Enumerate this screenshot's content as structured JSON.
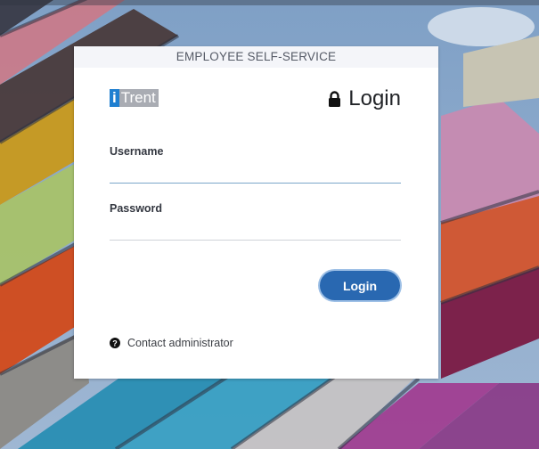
{
  "header": {
    "title": "EMPLOYEE SELF-SERVICE"
  },
  "brand": {
    "logo_i": "i",
    "logo_text": "Trent",
    "logo_i_color": "#1f7fd0",
    "logo_text_bg": "#a9acb3"
  },
  "login": {
    "title": "Login",
    "lock_icon": "lock-icon"
  },
  "form": {
    "username_label": "Username",
    "username_value": "",
    "password_label": "Password",
    "password_value": "",
    "submit_label": "Login",
    "accent_color": "#2968b1"
  },
  "footer": {
    "help_icon": "question-circle-icon",
    "contact_label": "Contact administrator"
  }
}
